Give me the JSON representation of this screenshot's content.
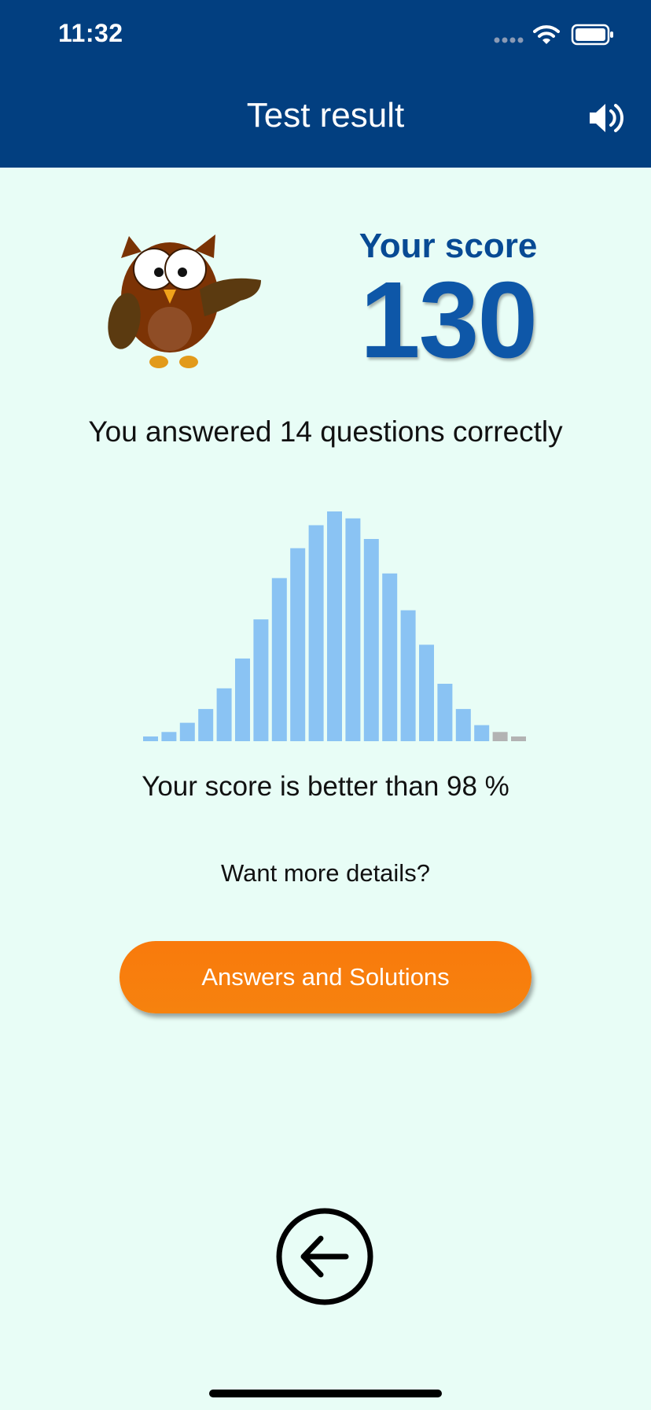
{
  "status_bar": {
    "time": "11:32",
    "icons": [
      "signal-dots-icon",
      "wifi-icon",
      "battery-icon"
    ]
  },
  "header": {
    "title": "Test result",
    "sound_icon": "speaker-icon"
  },
  "score": {
    "label": "Your score",
    "value": "130"
  },
  "summary": {
    "answered_text": "You answered 14 questions correctly"
  },
  "chart_data": {
    "type": "bar",
    "values": [
      2,
      4,
      8,
      14,
      23,
      36,
      53,
      71,
      84,
      94,
      100,
      97,
      88,
      73,
      57,
      42,
      25,
      14,
      7,
      4,
      2
    ],
    "highlighted_count": 19,
    "bar_color": "#8ac3f3",
    "dimmed_color": "#b3b3b3"
  },
  "percentile": {
    "text": "Your score is better than 98 %"
  },
  "details": {
    "prompt": "Want more details?",
    "button_label": "Answers and Solutions"
  },
  "navigation": {
    "back_icon": "back-arrow-icon"
  },
  "colors": {
    "header_bg": "#023f80",
    "page_bg": "#e8fdf6",
    "score_blue": "#0e57a8",
    "button_orange": "#f97a0c"
  }
}
